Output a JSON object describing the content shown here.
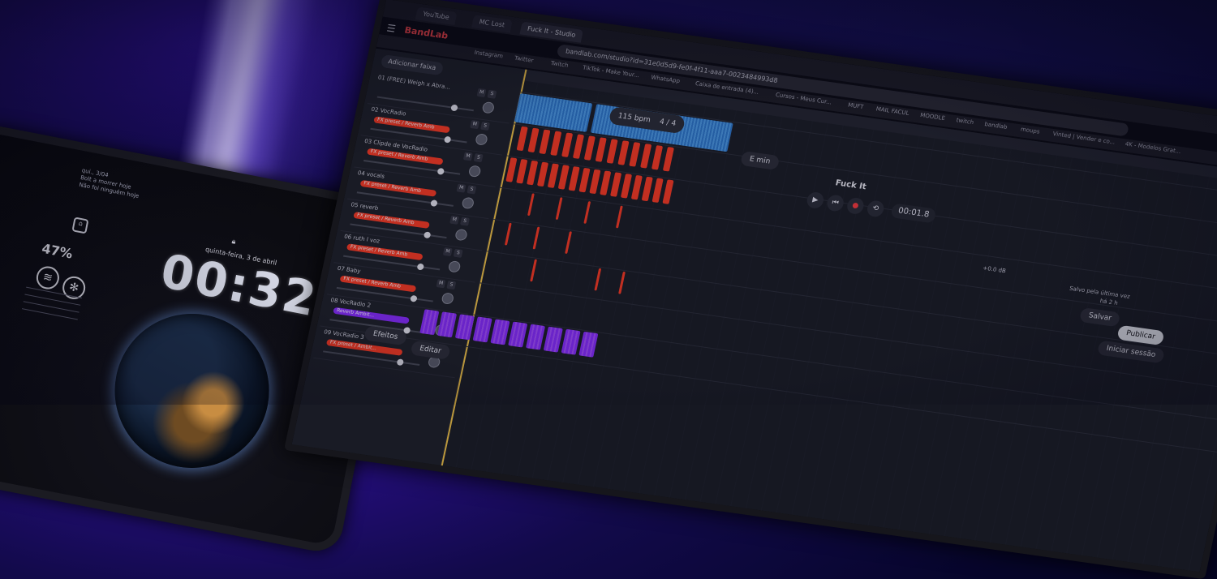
{
  "tablet": {
    "date_line": "qui., 3/04",
    "note_line1": "Bolt a morrer hoje",
    "note_line2": "Não foi ninguém hoje",
    "battery": "47%",
    "weekday_date": "quinta-feira, 3 de abril",
    "clock": "00:32",
    "apps": [
      "spotify-icon",
      "chatgpt-icon"
    ]
  },
  "browser": {
    "tabs": [
      "YouTube",
      "MC Lost",
      "Fuck It - Studio"
    ],
    "address": "bandlab.com/studio?id=31e0d5d9-fe0f-4f11-aaa7-0023484993d8",
    "bookmarks": [
      "Instagram",
      "Twitter",
      "Twitch",
      "TikTok - Make Your...",
      "WhatsApp",
      "Caixa de entrada (4)...",
      "Cursos - Meus Cur...",
      "MUFT",
      "MAIL FACUL",
      "MOODLE",
      "twitch",
      "bandlab",
      "moups",
      "Vinted | Vender e co...",
      "4K - Modelos Grat..."
    ]
  },
  "studio": {
    "brand": "BandLab",
    "add_track": "Adicionar faixa",
    "tracks": [
      {
        "name": "01 (FREE) Weigh x Abra...",
        "pill": "",
        "color": "#2f7fd6"
      },
      {
        "name": "02 VocRadio",
        "pill": "FX preset / Reverb Amb",
        "color": "#ff3b1f"
      },
      {
        "name": "03 Clipde de VocRadio",
        "pill": "FX preset / Reverb Amb",
        "color": "#ff3b1f"
      },
      {
        "name": "04 vocals",
        "pill": "FX preset / Reverb Amb",
        "color": "#ff3b1f"
      },
      {
        "name": "05 reverb",
        "pill": "FX preset / Reverb Amb",
        "color": "#ff3b1f"
      },
      {
        "name": "06 ruth l voz",
        "pill": "FX preset / Reverb Amb",
        "color": "#ff3b1f"
      },
      {
        "name": "07 Baby",
        "pill": "FX preset / Reverb Amb",
        "color": "#ff3b1f"
      },
      {
        "name": "08 VocRadio 2",
        "pill": "Reverb Ambit...",
        "color": "#8a2cff"
      },
      {
        "name": "09 VocRadio 3",
        "pill": "FX preset / Ambit...",
        "color": "#ff3b1f"
      }
    ],
    "tempo": "115 bpm",
    "time_sig": "4 / 4",
    "key": "E min",
    "song_title": "Fuck It",
    "time": "00:01.8",
    "volume_db": "+0.0 dB",
    "save_label": "Salvar",
    "publish_label": "Publicar",
    "signin_label": "Iniciar sessão",
    "last_saved": "Salvo pela última vez",
    "last_saved_time": "há 2 h",
    "bottom_label": "Editar",
    "bottom_label2": "Efeitos"
  }
}
